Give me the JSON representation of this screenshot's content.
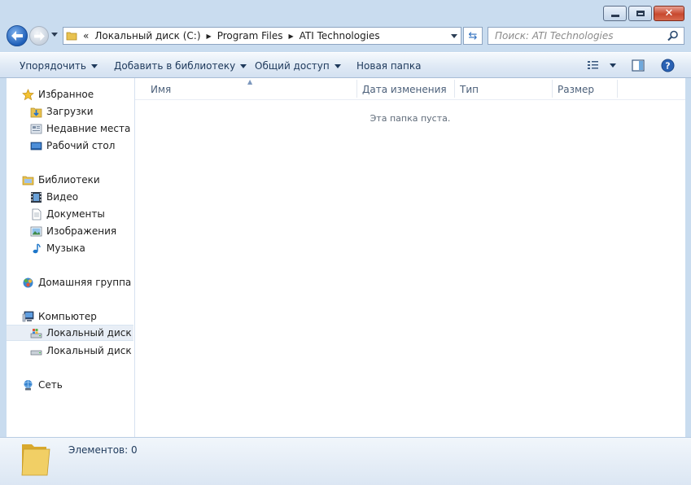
{
  "nav": {
    "breadcrumb_overflow": "«",
    "breadcrumb": [
      "Локальный диск (C:)",
      "Program Files",
      "ATI Technologies"
    ],
    "search_placeholder": "Поиск: ATI Technologies"
  },
  "toolbar": {
    "organize": "Упорядочить",
    "add_to_library": "Добавить в библиотеку",
    "share": "Общий доступ",
    "new_folder": "Новая папка"
  },
  "sidebar": {
    "favorites": {
      "label": "Избранное",
      "items": [
        "Загрузки",
        "Недавние места",
        "Рабочий стол"
      ]
    },
    "libraries": {
      "label": "Библиотеки",
      "items": [
        "Видео",
        "Документы",
        "Изображения",
        "Музыка"
      ]
    },
    "homegroup": {
      "label": "Домашняя группа"
    },
    "computer": {
      "label": "Компьютер",
      "items": [
        "Локальный диск (C:)",
        "Локальный диск (D:)"
      ]
    },
    "network": {
      "label": "Сеть"
    }
  },
  "columns": [
    "Имя",
    "Дата изменения",
    "Тип",
    "Размер"
  ],
  "empty_message": "Эта папка пуста.",
  "status": {
    "items_count": "Элементов: 0"
  },
  "colors": {
    "accent": "#1e395b",
    "window_frame": "#c9dcef",
    "selected_row": "#e8eef6"
  }
}
